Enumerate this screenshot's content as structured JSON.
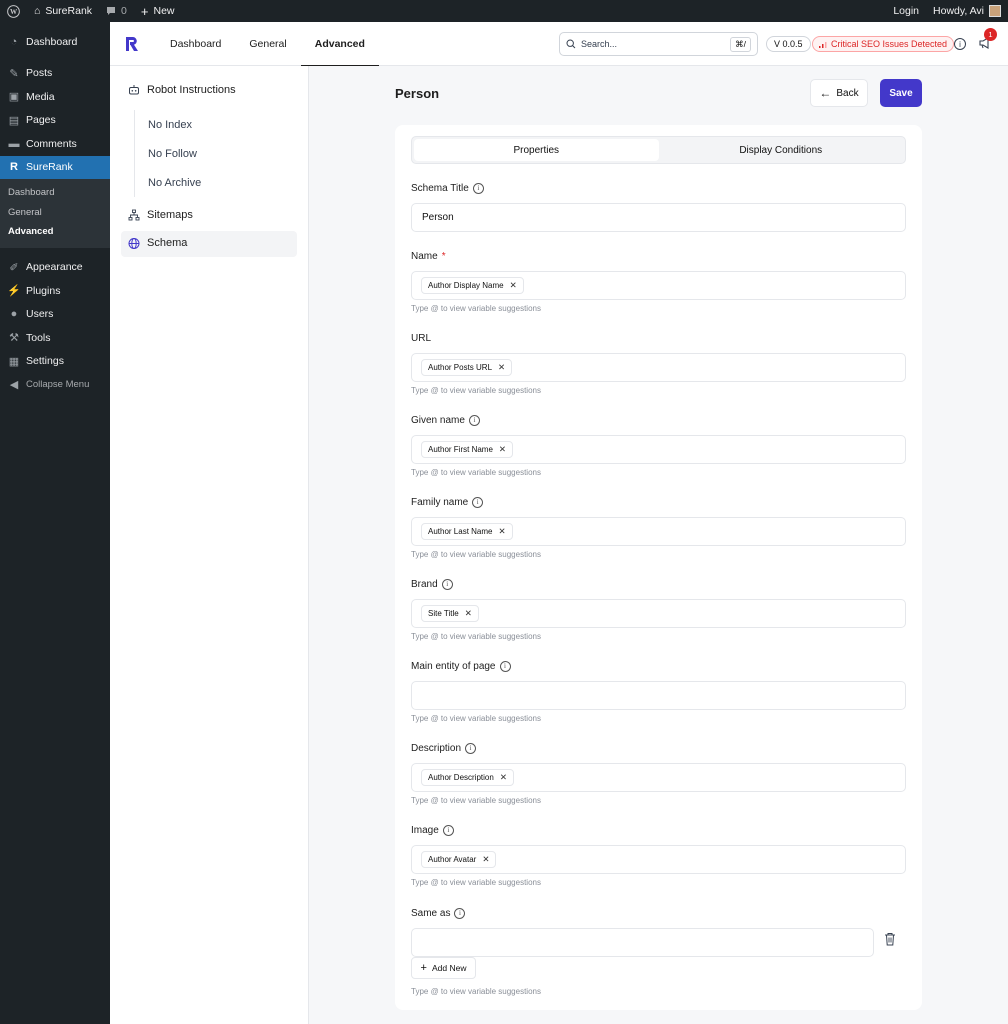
{
  "adminbar": {
    "site_name": "SureRank",
    "comments_count": "0",
    "new_label": "New",
    "login_label": "Login",
    "howdy": "Howdy, Avi"
  },
  "wp_menu": {
    "items_top": [
      {
        "label": "Dashboard",
        "icon": "dashboard-icon"
      }
    ],
    "items_mid": [
      {
        "label": "Posts",
        "icon": "pin-icon"
      },
      {
        "label": "Media",
        "icon": "media-icon"
      },
      {
        "label": "Pages",
        "icon": "pages-icon"
      },
      {
        "label": "Comments",
        "icon": "comment-icon"
      },
      {
        "label": "SureRank",
        "icon": "surerank-icon"
      }
    ],
    "surerank_sub": [
      "Dashboard",
      "General",
      "Advanced"
    ],
    "items_bottom": [
      {
        "label": "Appearance",
        "icon": "brush-icon"
      },
      {
        "label": "Plugins",
        "icon": "plug-icon"
      },
      {
        "label": "Users",
        "icon": "user-icon"
      },
      {
        "label": "Tools",
        "icon": "wrench-icon"
      },
      {
        "label": "Settings",
        "icon": "settings-icon"
      }
    ],
    "collapse_label": "Collapse Menu"
  },
  "topbar": {
    "tabs": [
      "Dashboard",
      "General",
      "Advanced"
    ],
    "active_tab": "Advanced",
    "search_placeholder": "Search...",
    "search_shortcut": "⌘/",
    "version": "V 0.0.5",
    "seo_alert": "Critical SEO Issues Detected",
    "notification_count": "1"
  },
  "plugin_sidebar": {
    "robot_label": "Robot Instructions",
    "robot_items": [
      "No Index",
      "No Follow",
      "No Archive"
    ],
    "sitemaps_label": "Sitemaps",
    "schema_label": "Schema"
  },
  "page": {
    "title": "Person",
    "back_label": "Back",
    "save_label": "Save",
    "tabs": [
      "Properties",
      "Display Conditions"
    ],
    "schema_title_label": "Schema Title",
    "schema_title_value": "Person",
    "hint": "Type @ to view variable suggestions",
    "add_new_label": "Add New",
    "fields": [
      {
        "label": "Name",
        "required": "*",
        "chip": "Author Display Name"
      },
      {
        "label": "URL",
        "chip": "Author Posts URL"
      },
      {
        "label": "Given name",
        "chip": "Author First Name"
      },
      {
        "label": "Family name",
        "chip": "Author Last Name"
      },
      {
        "label": "Brand",
        "chip": "Site Title"
      },
      {
        "label": "Main entity of page",
        "chip": ""
      },
      {
        "label": "Description",
        "chip": "Author Description"
      },
      {
        "label": "Image",
        "chip": "Author Avatar"
      },
      {
        "label": "Same as",
        "chip": ""
      }
    ]
  },
  "colors": {
    "primary": "#4338ca",
    "wp_dark": "#1d2327",
    "wp_active": "#2271b1",
    "danger": "#dc2626"
  }
}
